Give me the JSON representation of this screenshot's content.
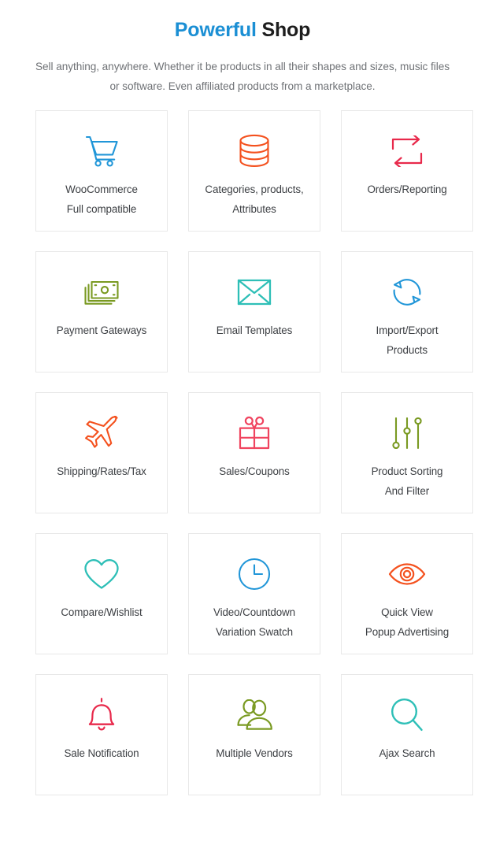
{
  "header": {
    "title_accent": "Powerful",
    "title_plain": "Shop",
    "subtitle": "Sell anything, anywhere. Whether it be products in all their shapes and sizes, music files or software. Even affiliated products from a marketplace.",
    "accent_color": "#1b8fd4",
    "plain_color": "#1d1d1d",
    "subtitle_color": "#6f7276"
  },
  "colors": {
    "blue": "#2196d8",
    "orange": "#f4511e",
    "crimson": "#e8294b",
    "olive": "#7a9a22",
    "teal": "#2ebfb7",
    "pink": "#f0445f",
    "card_border": "#e8e8e8",
    "label": "#3c3f43",
    "background": "#ffffff"
  },
  "features": [
    {
      "icon": "shopping-cart-icon",
      "color": "#2196d8",
      "line1": "WooCommerce",
      "line2": "Full compatible"
    },
    {
      "icon": "database-stack-icon",
      "color": "#f4511e",
      "line1": "Categories, products,",
      "line2": "Attributes"
    },
    {
      "icon": "exchange-arrows-icon",
      "color": "#e8294b",
      "line1": "Orders/Reporting",
      "line2": ""
    },
    {
      "icon": "banknotes-icon",
      "color": "#7a9a22",
      "line1": "Payment Gateways",
      "line2": ""
    },
    {
      "icon": "envelope-icon",
      "color": "#2ebfb7",
      "line1": "Email Templates",
      "line2": ""
    },
    {
      "icon": "refresh-circle-icon",
      "color": "#2196d8",
      "line1": "Import/Export",
      "line2": "Products"
    },
    {
      "icon": "airplane-icon",
      "color": "#f4511e",
      "line1": "Shipping/Rates/Tax",
      "line2": ""
    },
    {
      "icon": "gift-box-icon",
      "color": "#f0445f",
      "line1": "Sales/Coupons",
      "line2": ""
    },
    {
      "icon": "sliders-icon",
      "color": "#7a9a22",
      "line1": "Product Sorting",
      "line2": "And Filter"
    },
    {
      "icon": "heart-icon",
      "color": "#2ebfb7",
      "line1": "Compare/Wishlist",
      "line2": ""
    },
    {
      "icon": "clock-icon",
      "color": "#2196d8",
      "line1": "Video/Countdown",
      "line2": "Variation Swatch"
    },
    {
      "icon": "eye-icon",
      "color": "#f4511e",
      "line1": "Quick View",
      "line2": "Popup Advertising"
    },
    {
      "icon": "bell-icon",
      "color": "#e8294b",
      "line1": "Sale Notification",
      "line2": ""
    },
    {
      "icon": "users-group-icon",
      "color": "#7a9a22",
      "line1": "Multiple Vendors",
      "line2": ""
    },
    {
      "icon": "magnifier-icon",
      "color": "#2ebfb7",
      "line1": "Ajax Search",
      "line2": ""
    }
  ]
}
